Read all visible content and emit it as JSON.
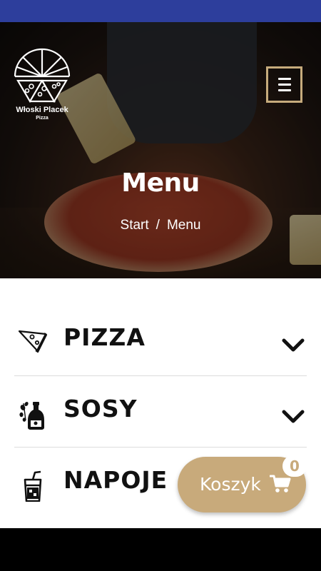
{
  "brand": {
    "name": "Włoski Placek",
    "subtitle": "Pizza"
  },
  "header": {
    "menu_icon": "hamburger-icon",
    "accent": "#c6ab7c"
  },
  "hero": {
    "title": "Menu",
    "breadcrumb": [
      "Start",
      "Menu"
    ],
    "separator": "/"
  },
  "categories": [
    {
      "label": "PIZZA",
      "icon": "pizza-slice-icon",
      "expand_icon": "chevron-down-icon"
    },
    {
      "label": "SOSY",
      "icon": "sauce-bottle-icon",
      "expand_icon": "chevron-down-icon"
    },
    {
      "label": "NAPOJE",
      "icon": "drink-cup-icon"
    }
  ],
  "cart": {
    "label": "Koszyk",
    "count": "0",
    "icon": "cart-icon",
    "color": "#c8aa7b"
  },
  "colors": {
    "status_bar": "#2d3e9c",
    "accent": "#c8aa7b"
  }
}
